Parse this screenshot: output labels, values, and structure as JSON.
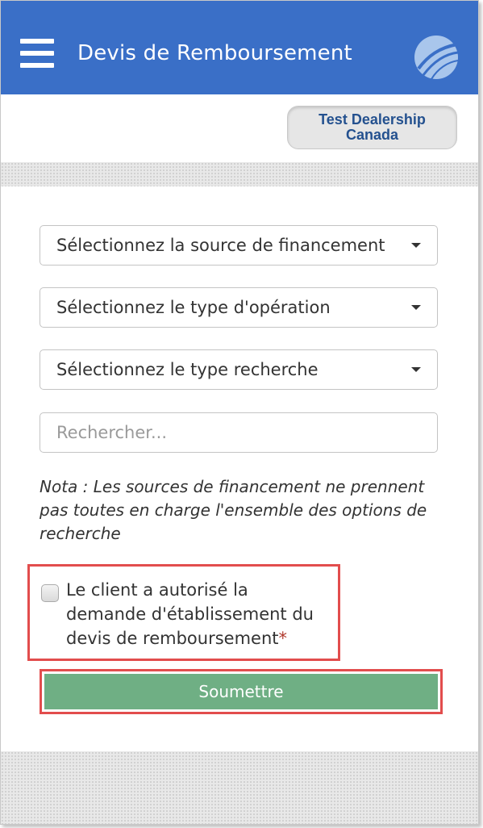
{
  "header": {
    "title": "Devis de Remboursement",
    "menu_icon": "hamburger-menu-icon",
    "logo_icon": "globe-swoosh-logo"
  },
  "dealer": {
    "line1": "Test Dealership",
    "line2": "Canada"
  },
  "form": {
    "financing_source": "Sélectionnez la source de financement",
    "operation_type": "Sélectionnez le type d'opération",
    "search_type": "Sélectionnez le type recherche",
    "search_placeholder": "Rechercher...",
    "note": "Nota : Les sources de financement ne prennent pas toutes en charge l'ensemble des options de recherche",
    "consent_label": "Le client a autorisé la demande d'établissement du devis de remboursement",
    "required_mark": "*",
    "submit_label": "Soumettre"
  },
  "colors": {
    "header_bg": "#3a6fc7",
    "submit_bg": "#6faf84",
    "highlight": "#e24d4d",
    "dealer_text": "#24518f"
  }
}
